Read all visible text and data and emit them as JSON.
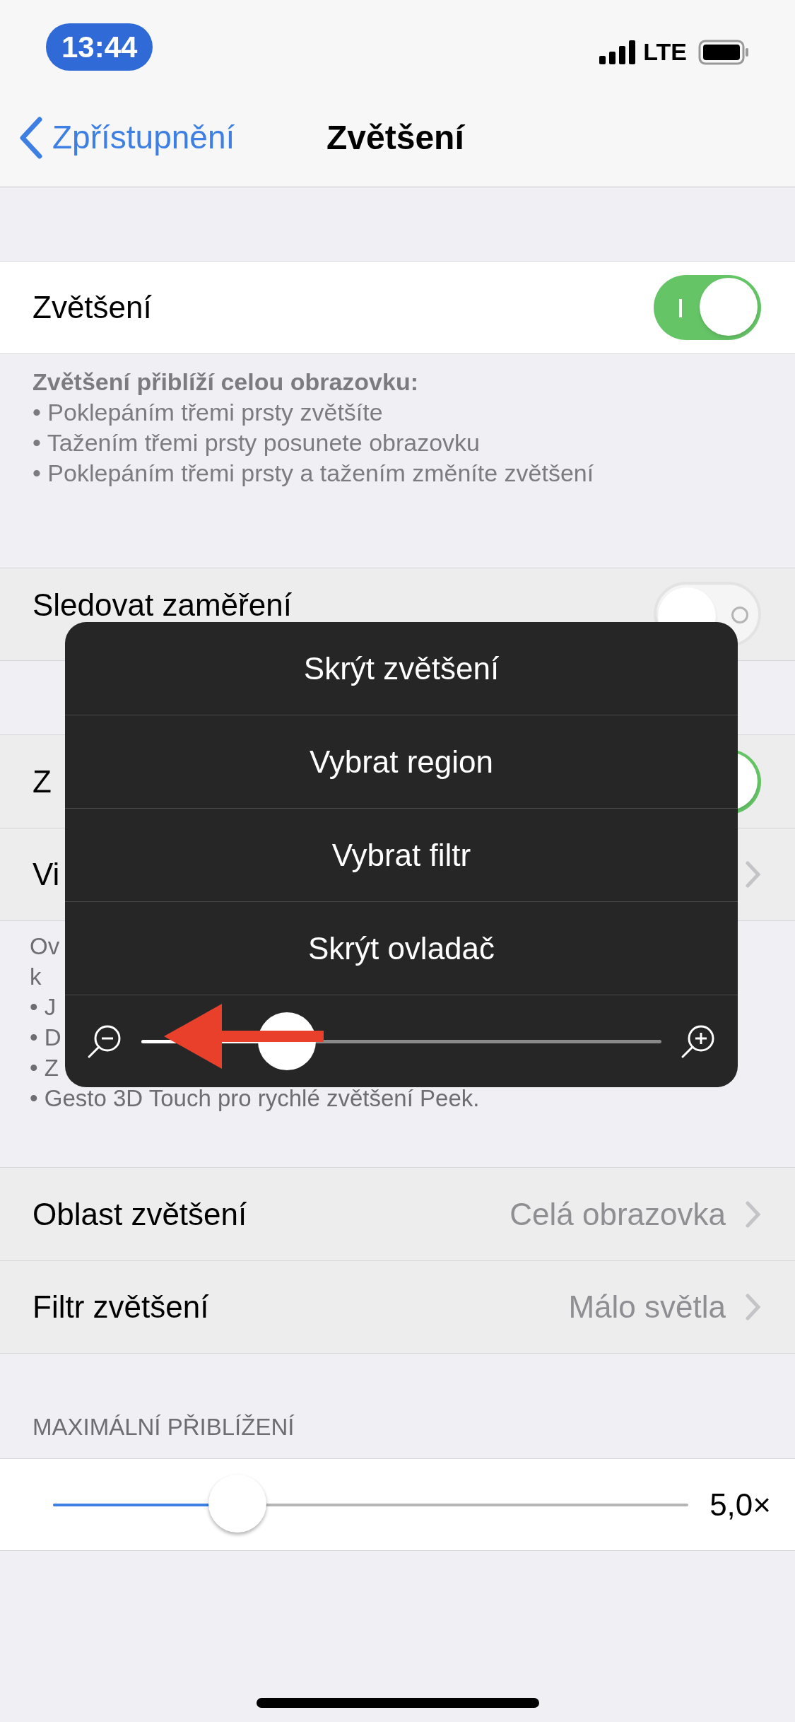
{
  "status_bar": {
    "time": "13:44",
    "network": "LTE"
  },
  "nav": {
    "back": "Zpřístupnění",
    "title": "Zvětšení"
  },
  "zoom_row": {
    "label": "Zvětšení",
    "on": true
  },
  "zoom_footer": {
    "heading": "Zvětšení přiblíží celou obrazovku:",
    "bullets": [
      "• Poklepáním třemi prsty zvětšíte",
      "• Tažením třemi prsty posunete obrazovku",
      "• Poklepáním třemi prsty a tažením změníte zvětšení"
    ]
  },
  "focus_row": {
    "label": "Sledovat zaměření",
    "on": false
  },
  "rows_under": [
    {
      "label": "Z",
      "kind": "toggle",
      "on": true
    },
    {
      "label": "Vi",
      "kind": "link"
    }
  ],
  "under_footer": {
    "lines": [
      "Ov",
      "k"
    ],
    "bullets": [
      "• J",
      "• D",
      "• Z",
      "• Gesto 3D Touch pro rychlé zvětšení Peek."
    ]
  },
  "settings": [
    {
      "label": "Oblast zvětšení",
      "value": "Celá obrazovka"
    },
    {
      "label": "Filtr zvětšení",
      "value": "Málo světla"
    }
  ],
  "max_zoom": {
    "header": "MAXIMÁLNÍ PŘIBLÍŽENÍ",
    "level": 0.29,
    "reading": "5,0×"
  },
  "menu": {
    "items": [
      "Skrýt zvětšení",
      "Vybrat region",
      "Vybrat filtr",
      "Skrýt ovladač"
    ],
    "slider": {
      "level": 0.28
    }
  }
}
